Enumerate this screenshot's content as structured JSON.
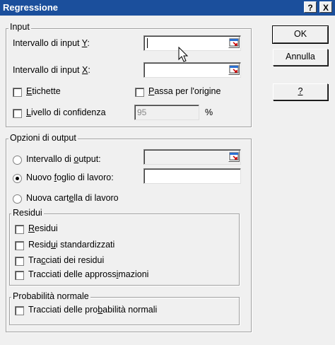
{
  "window": {
    "title": "Regressione",
    "help_label": "?",
    "close_label": "X"
  },
  "buttons": {
    "ok": "OK",
    "cancel": "Annulla",
    "help": "?"
  },
  "input": {
    "legend": "Input",
    "y_label_pre": "Intervallo di input ",
    "y_label_key": "Y",
    "y_label_post": ":",
    "y_value": "",
    "x_label_pre": "Intervallo di input ",
    "x_label_key": "X",
    "x_label_post": ":",
    "x_value": "",
    "labels_key": "E",
    "labels_rest": "tichette",
    "labels_checked": false,
    "origin_key": "P",
    "origin_rest": "assa per l'origine",
    "origin_checked": false,
    "confidence_key": "L",
    "confidence_rest": "ivello di confidenza",
    "confidence_checked": false,
    "confidence_value": "95",
    "percent": "%"
  },
  "output": {
    "legend": "Opzioni di output",
    "range_pre": "Intervallo di ",
    "range_key": "o",
    "range_post": "utput:",
    "newsheet_pre": "Nuovo ",
    "newsheet_key": "f",
    "newsheet_post": "oglio di lavoro:",
    "newworkbook_pre": "Nuova cart",
    "newworkbook_key": "e",
    "newworkbook_post": "lla di lavoro",
    "selected": "newsheet"
  },
  "residuals": {
    "legend": "Residui",
    "residuals_key": "R",
    "residuals_rest": "esidui",
    "standardized_pre": "Resid",
    "standardized_key": "u",
    "standardized_post": "i standardizzati",
    "plots_pre": "Tra",
    "plots_key": "c",
    "plots_post": "ciati dei residui",
    "fit_pre": "Tracciati delle appross",
    "fit_key": "i",
    "fit_post": "mazioni"
  },
  "normal": {
    "legend": "Probabilità normale",
    "plots_pre": "Tracciati delle pro",
    "plots_key": "b",
    "plots_post": "abilità normali"
  }
}
